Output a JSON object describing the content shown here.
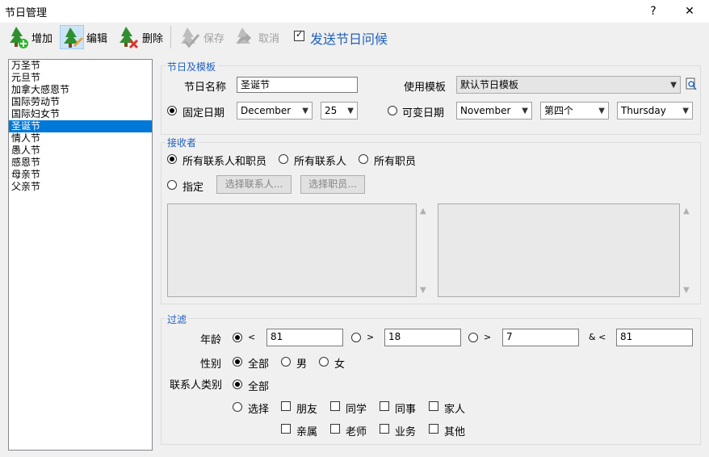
{
  "window": {
    "title": "节日管理",
    "help": "?",
    "close": "✕"
  },
  "toolbar": {
    "add": "增加",
    "edit": "编辑",
    "delete": "删除",
    "save": "保存",
    "cancel": "取消",
    "send_label": "发送节日问候"
  },
  "holidays": [
    "万圣节",
    "元旦节",
    "加拿大感恩节",
    "国际劳动节",
    "国际妇女节",
    "圣诞节",
    "情人节",
    "愚人节",
    "感恩节",
    "母亲节",
    "父亲节"
  ],
  "selected_holiday": "圣诞节",
  "holiday_template": {
    "group_title": "节日及模板",
    "name_label": "节日名称",
    "name_value": "圣诞节",
    "template_label": "使用模板",
    "template_value": "默认节日模板",
    "fixed_date_label": "固定日期",
    "fixed_month": "December",
    "fixed_day": "25",
    "variable_date_label": "可变日期",
    "var_month": "November",
    "var_week": "第四个",
    "var_weekday": "Thursday"
  },
  "recipients": {
    "group_title": "接收者",
    "opt_all_both": "所有联系人和职员",
    "opt_all_contacts": "所有联系人",
    "opt_all_staff": "所有职员",
    "opt_specify": "指定",
    "btn_choose_contacts": "选择联系人...",
    "btn_choose_staff": "选择职员..."
  },
  "filter": {
    "group_title": "过滤",
    "age_label": "年龄",
    "lt": "<",
    "gt": ">",
    "and_lt": "& <",
    "age_lt_value": "81",
    "age_gt_value": "18",
    "age_gt2_value": "7",
    "age_and_lt_value": "81",
    "gender_label": "性别",
    "gender_all": "全部",
    "gender_male": "男",
    "gender_female": "女",
    "contact_type_label": "联系人类别",
    "type_all": "全部",
    "type_select": "选择",
    "types": [
      "朋友",
      "同学",
      "同事",
      "家人",
      "亲属",
      "老师",
      "业务",
      "其他"
    ]
  }
}
